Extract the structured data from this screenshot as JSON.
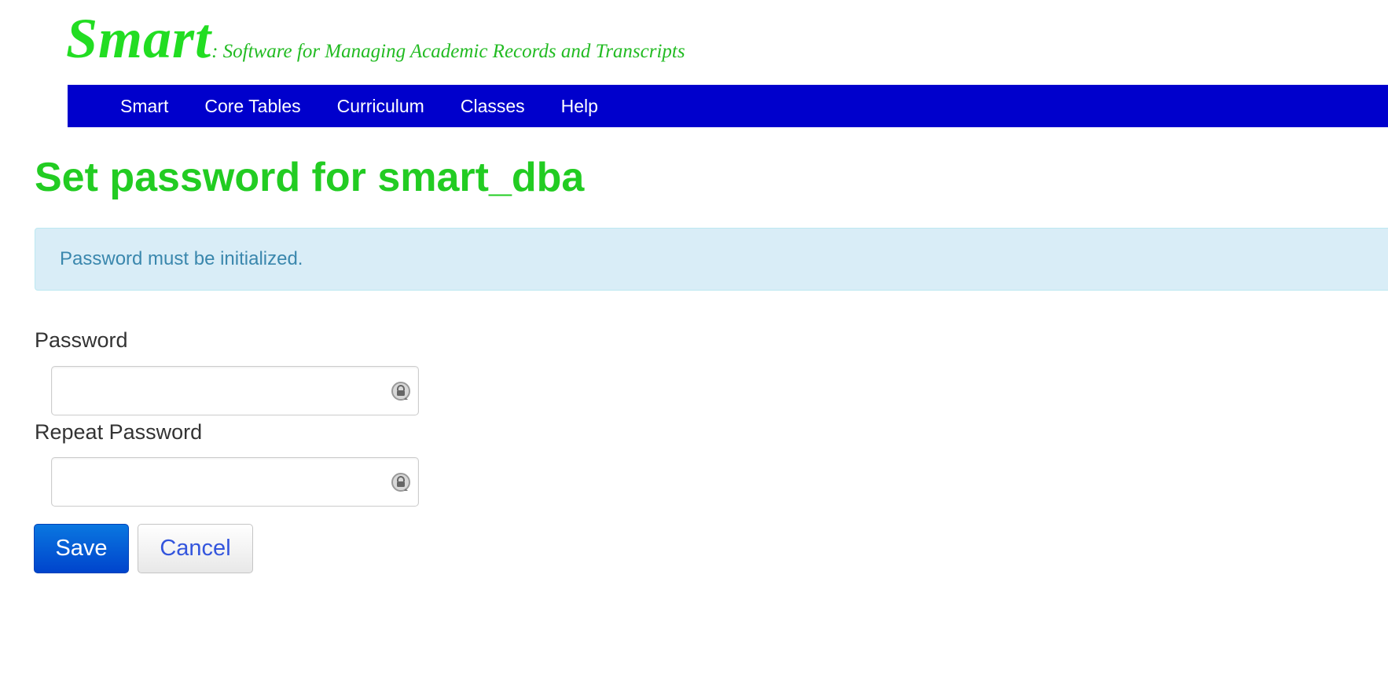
{
  "brand": {
    "name": "Smart",
    "tagline": ": Software for Managing Academic Records and Transcripts"
  },
  "nav": {
    "items": [
      {
        "label": "Smart"
      },
      {
        "label": "Core Tables"
      },
      {
        "label": "Curriculum"
      },
      {
        "label": "Classes"
      },
      {
        "label": "Help"
      }
    ]
  },
  "page": {
    "title": "Set password for smart_dba"
  },
  "alert": {
    "message": "Password must be initialized."
  },
  "form": {
    "password": {
      "label": "Password",
      "value": "",
      "icon": "keychain-icon"
    },
    "repeat_password": {
      "label": "Repeat Password",
      "value": "",
      "icon": "keychain-icon"
    },
    "save_label": "Save",
    "cancel_label": "Cancel"
  },
  "colors": {
    "brand_green": "#22dd22",
    "nav_background": "#0000cc",
    "title_green": "#22cc22",
    "alert_background": "#d9edf7",
    "alert_text": "#3a87ad",
    "primary_button": "#0055cc"
  }
}
